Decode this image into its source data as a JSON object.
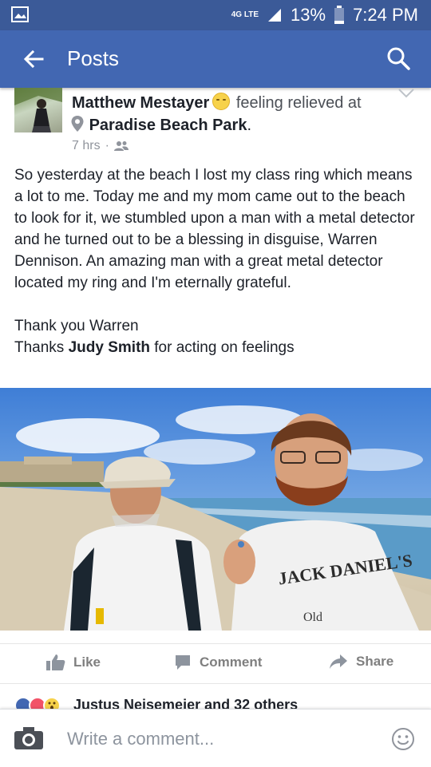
{
  "status_bar": {
    "network": "4G LTE",
    "battery": "13%",
    "time": "7:24 PM"
  },
  "header": {
    "title": "Posts",
    "back_icon": "arrow-left-icon",
    "search_icon": "search-icon"
  },
  "post": {
    "author": "Matthew Mestayer",
    "feeling_emoji": "relieved-face-icon",
    "feeling": "feeling relieved at",
    "place": "Paradise Beach Park",
    "place_suffix": ".",
    "time": "7 hrs",
    "separator": "·",
    "audience_icon": "friends-icon",
    "body_paragraph": "So yesterday at the beach I lost my class ring which means a lot to me. Today me and my mom came out to the beach to look for it, we stumbled upon a man with a metal detector  and he turned out to be a blessing in disguise, Warren Dennison. An amazing man with a great metal detector located my ring and I'm eternally grateful.",
    "thanks_line": "Thank you Warren",
    "mention_prefix": "Thanks ",
    "mention_name": "Judy Smith",
    "mention_suffix": " for acting on feelings",
    "photo_shirt_text_1": "JACK DANIEL'S",
    "photo_shirt_text_2": "Old"
  },
  "actions": {
    "like": "Like",
    "comment": "Comment",
    "share": "Share"
  },
  "reactions": {
    "icons": [
      "like-reaction-icon",
      "love-reaction-icon",
      "wow-reaction-icon"
    ],
    "summary": "Justus Neisemeier and 32 others"
  },
  "composer": {
    "placeholder": "Write a comment...",
    "camera_icon": "camera-icon",
    "emoji_icon": "smiley-icon"
  },
  "colors": {
    "status_bar": "#3b5a98",
    "app_bar": "#4267b2",
    "muted_text": "#90949c",
    "action_text": "#7f7f7f"
  }
}
